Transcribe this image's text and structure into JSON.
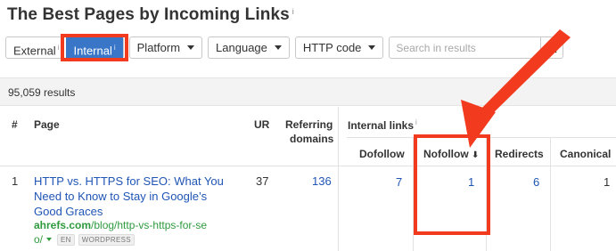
{
  "title": "The Best Pages by Incoming Links",
  "title_info": "i",
  "filters": {
    "tabs": [
      {
        "label": "External",
        "info": "i",
        "active": false
      },
      {
        "label": "Internal",
        "info": "i",
        "active": true
      }
    ],
    "dropdowns": [
      {
        "label": "Platform"
      },
      {
        "label": "Language"
      },
      {
        "label": "HTTP code"
      }
    ],
    "search_placeholder": "Search in results"
  },
  "results_count": "95,059 results",
  "table": {
    "headers": {
      "index": "#",
      "page": "Page",
      "ur": "UR",
      "referring_domains_1": "Referring",
      "referring_domains_2": "domains",
      "internal_links": "Internal links",
      "internal_links_info": "i",
      "dofollow": "Dofollow",
      "nofollow": "Nofollow",
      "nofollow_sort": "⬇",
      "redirects": "Redirects",
      "canonical": "Canonical"
    },
    "rows": [
      {
        "index": "1",
        "title": "HTTP vs. HTTPS for SEO: What You Need to Know to Stay in Google’s Good Graces",
        "url_domain": "ahrefs.com",
        "url_path": "/blog/http-vs-https-for-se",
        "url_path_cont": "o/",
        "lang_badge": "EN",
        "platform_badge": "WORDPRESS",
        "ur": "37",
        "referring_domains": "136",
        "dofollow": "7",
        "nofollow": "1",
        "redirects": "6",
        "canonical": "1"
      }
    ]
  },
  "colors": {
    "accent_blue": "#3a76c8",
    "link_blue": "#1f55b5",
    "url_green": "#2f9a3e",
    "annotation_red": "#f23a1f"
  },
  "icons": [
    "info-icon",
    "caret-down-icon",
    "search-icon",
    "sort-down-icon",
    "annotation-arrow-icon"
  ]
}
